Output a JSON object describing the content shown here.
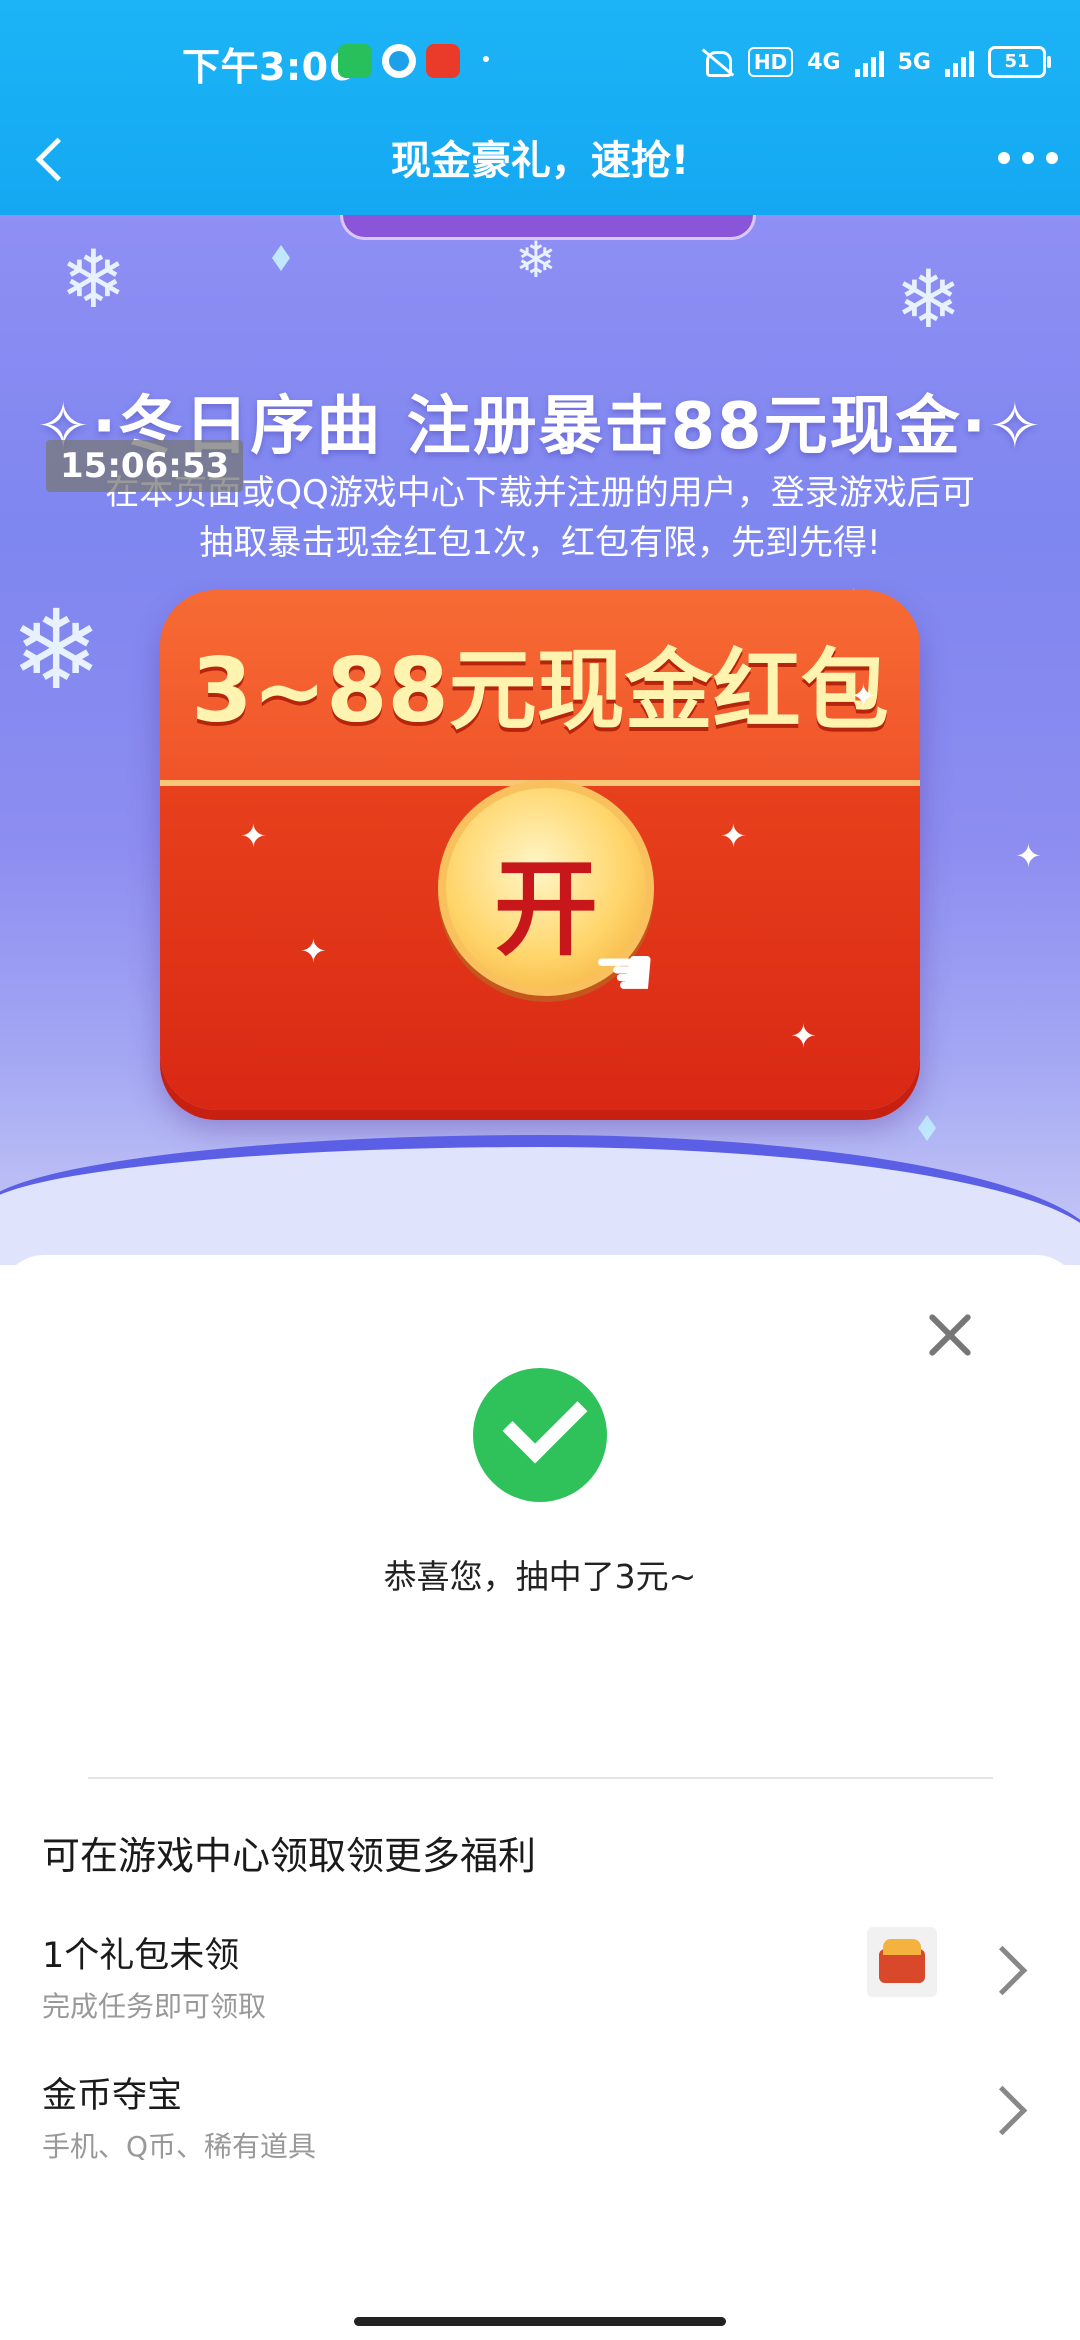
{
  "status_bar": {
    "time": "下午3:06",
    "network_label": "HD",
    "signal1_label": "4G",
    "signal2_label": "5G",
    "battery": "51"
  },
  "navbar": {
    "title": "现金豪礼，速抢!"
  },
  "banner": {
    "headline": "✧·冬日序曲 注册暴击88元现金·✧",
    "timestamp": "15:06:53",
    "subtitle_line1": "在本页面或QQ游戏中心下载并注册的用户，登录游戏后可",
    "subtitle_line2": "抽取暴击现金红包1次，红包有限，先到先得!",
    "envelope_title": "3~88元现金红包",
    "open_button": "开"
  },
  "result_sheet": {
    "result_text": "恭喜您，抽中了3元~",
    "section_title": "可在游戏中心领取领更多福利",
    "items": [
      {
        "title": "1个礼包未领",
        "desc": "完成任务即可领取",
        "icon": "gift-chest-icon"
      },
      {
        "title": "金币夺宝",
        "desc": "手机、Q币、稀有道具"
      }
    ]
  },
  "colors": {
    "topbar": "#1cb4f6",
    "envelope": "#e73f1c",
    "success": "#2fc25b"
  }
}
